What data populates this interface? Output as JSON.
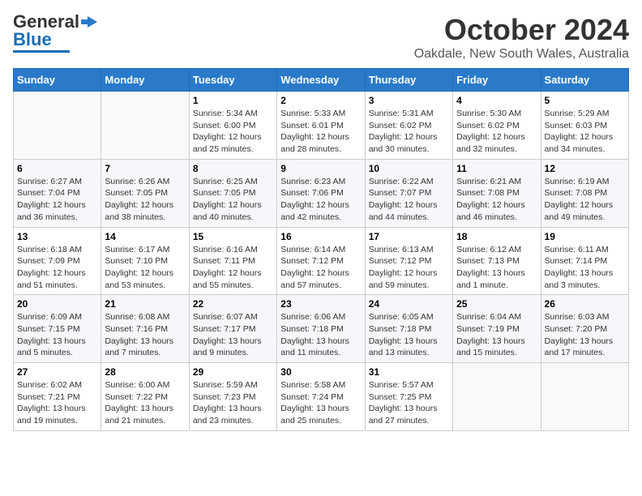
{
  "logo": {
    "general": "General",
    "blue": "Blue"
  },
  "header": {
    "month": "October 2024",
    "location": "Oakdale, New South Wales, Australia"
  },
  "weekdays": [
    "Sunday",
    "Monday",
    "Tuesday",
    "Wednesday",
    "Thursday",
    "Friday",
    "Saturday"
  ],
  "weeks": [
    [
      {
        "day": "",
        "info": ""
      },
      {
        "day": "",
        "info": ""
      },
      {
        "day": "1",
        "info": "Sunrise: 5:34 AM\nSunset: 6:00 PM\nDaylight: 12 hours\nand 25 minutes."
      },
      {
        "day": "2",
        "info": "Sunrise: 5:33 AM\nSunset: 6:01 PM\nDaylight: 12 hours\nand 28 minutes."
      },
      {
        "day": "3",
        "info": "Sunrise: 5:31 AM\nSunset: 6:02 PM\nDaylight: 12 hours\nand 30 minutes."
      },
      {
        "day": "4",
        "info": "Sunrise: 5:30 AM\nSunset: 6:02 PM\nDaylight: 12 hours\nand 32 minutes."
      },
      {
        "day": "5",
        "info": "Sunrise: 5:29 AM\nSunset: 6:03 PM\nDaylight: 12 hours\nand 34 minutes."
      }
    ],
    [
      {
        "day": "6",
        "info": "Sunrise: 6:27 AM\nSunset: 7:04 PM\nDaylight: 12 hours\nand 36 minutes."
      },
      {
        "day": "7",
        "info": "Sunrise: 6:26 AM\nSunset: 7:05 PM\nDaylight: 12 hours\nand 38 minutes."
      },
      {
        "day": "8",
        "info": "Sunrise: 6:25 AM\nSunset: 7:05 PM\nDaylight: 12 hours\nand 40 minutes."
      },
      {
        "day": "9",
        "info": "Sunrise: 6:23 AM\nSunset: 7:06 PM\nDaylight: 12 hours\nand 42 minutes."
      },
      {
        "day": "10",
        "info": "Sunrise: 6:22 AM\nSunset: 7:07 PM\nDaylight: 12 hours\nand 44 minutes."
      },
      {
        "day": "11",
        "info": "Sunrise: 6:21 AM\nSunset: 7:08 PM\nDaylight: 12 hours\nand 46 minutes."
      },
      {
        "day": "12",
        "info": "Sunrise: 6:19 AM\nSunset: 7:08 PM\nDaylight: 12 hours\nand 49 minutes."
      }
    ],
    [
      {
        "day": "13",
        "info": "Sunrise: 6:18 AM\nSunset: 7:09 PM\nDaylight: 12 hours\nand 51 minutes."
      },
      {
        "day": "14",
        "info": "Sunrise: 6:17 AM\nSunset: 7:10 PM\nDaylight: 12 hours\nand 53 minutes."
      },
      {
        "day": "15",
        "info": "Sunrise: 6:16 AM\nSunset: 7:11 PM\nDaylight: 12 hours\nand 55 minutes."
      },
      {
        "day": "16",
        "info": "Sunrise: 6:14 AM\nSunset: 7:12 PM\nDaylight: 12 hours\nand 57 minutes."
      },
      {
        "day": "17",
        "info": "Sunrise: 6:13 AM\nSunset: 7:12 PM\nDaylight: 12 hours\nand 59 minutes."
      },
      {
        "day": "18",
        "info": "Sunrise: 6:12 AM\nSunset: 7:13 PM\nDaylight: 13 hours\nand 1 minute."
      },
      {
        "day": "19",
        "info": "Sunrise: 6:11 AM\nSunset: 7:14 PM\nDaylight: 13 hours\nand 3 minutes."
      }
    ],
    [
      {
        "day": "20",
        "info": "Sunrise: 6:09 AM\nSunset: 7:15 PM\nDaylight: 13 hours\nand 5 minutes."
      },
      {
        "day": "21",
        "info": "Sunrise: 6:08 AM\nSunset: 7:16 PM\nDaylight: 13 hours\nand 7 minutes."
      },
      {
        "day": "22",
        "info": "Sunrise: 6:07 AM\nSunset: 7:17 PM\nDaylight: 13 hours\nand 9 minutes."
      },
      {
        "day": "23",
        "info": "Sunrise: 6:06 AM\nSunset: 7:18 PM\nDaylight: 13 hours\nand 11 minutes."
      },
      {
        "day": "24",
        "info": "Sunrise: 6:05 AM\nSunset: 7:18 PM\nDaylight: 13 hours\nand 13 minutes."
      },
      {
        "day": "25",
        "info": "Sunrise: 6:04 AM\nSunset: 7:19 PM\nDaylight: 13 hours\nand 15 minutes."
      },
      {
        "day": "26",
        "info": "Sunrise: 6:03 AM\nSunset: 7:20 PM\nDaylight: 13 hours\nand 17 minutes."
      }
    ],
    [
      {
        "day": "27",
        "info": "Sunrise: 6:02 AM\nSunset: 7:21 PM\nDaylight: 13 hours\nand 19 minutes."
      },
      {
        "day": "28",
        "info": "Sunrise: 6:00 AM\nSunset: 7:22 PM\nDaylight: 13 hours\nand 21 minutes."
      },
      {
        "day": "29",
        "info": "Sunrise: 5:59 AM\nSunset: 7:23 PM\nDaylight: 13 hours\nand 23 minutes."
      },
      {
        "day": "30",
        "info": "Sunrise: 5:58 AM\nSunset: 7:24 PM\nDaylight: 13 hours\nand 25 minutes."
      },
      {
        "day": "31",
        "info": "Sunrise: 5:57 AM\nSunset: 7:25 PM\nDaylight: 13 hours\nand 27 minutes."
      },
      {
        "day": "",
        "info": ""
      },
      {
        "day": "",
        "info": ""
      }
    ]
  ]
}
